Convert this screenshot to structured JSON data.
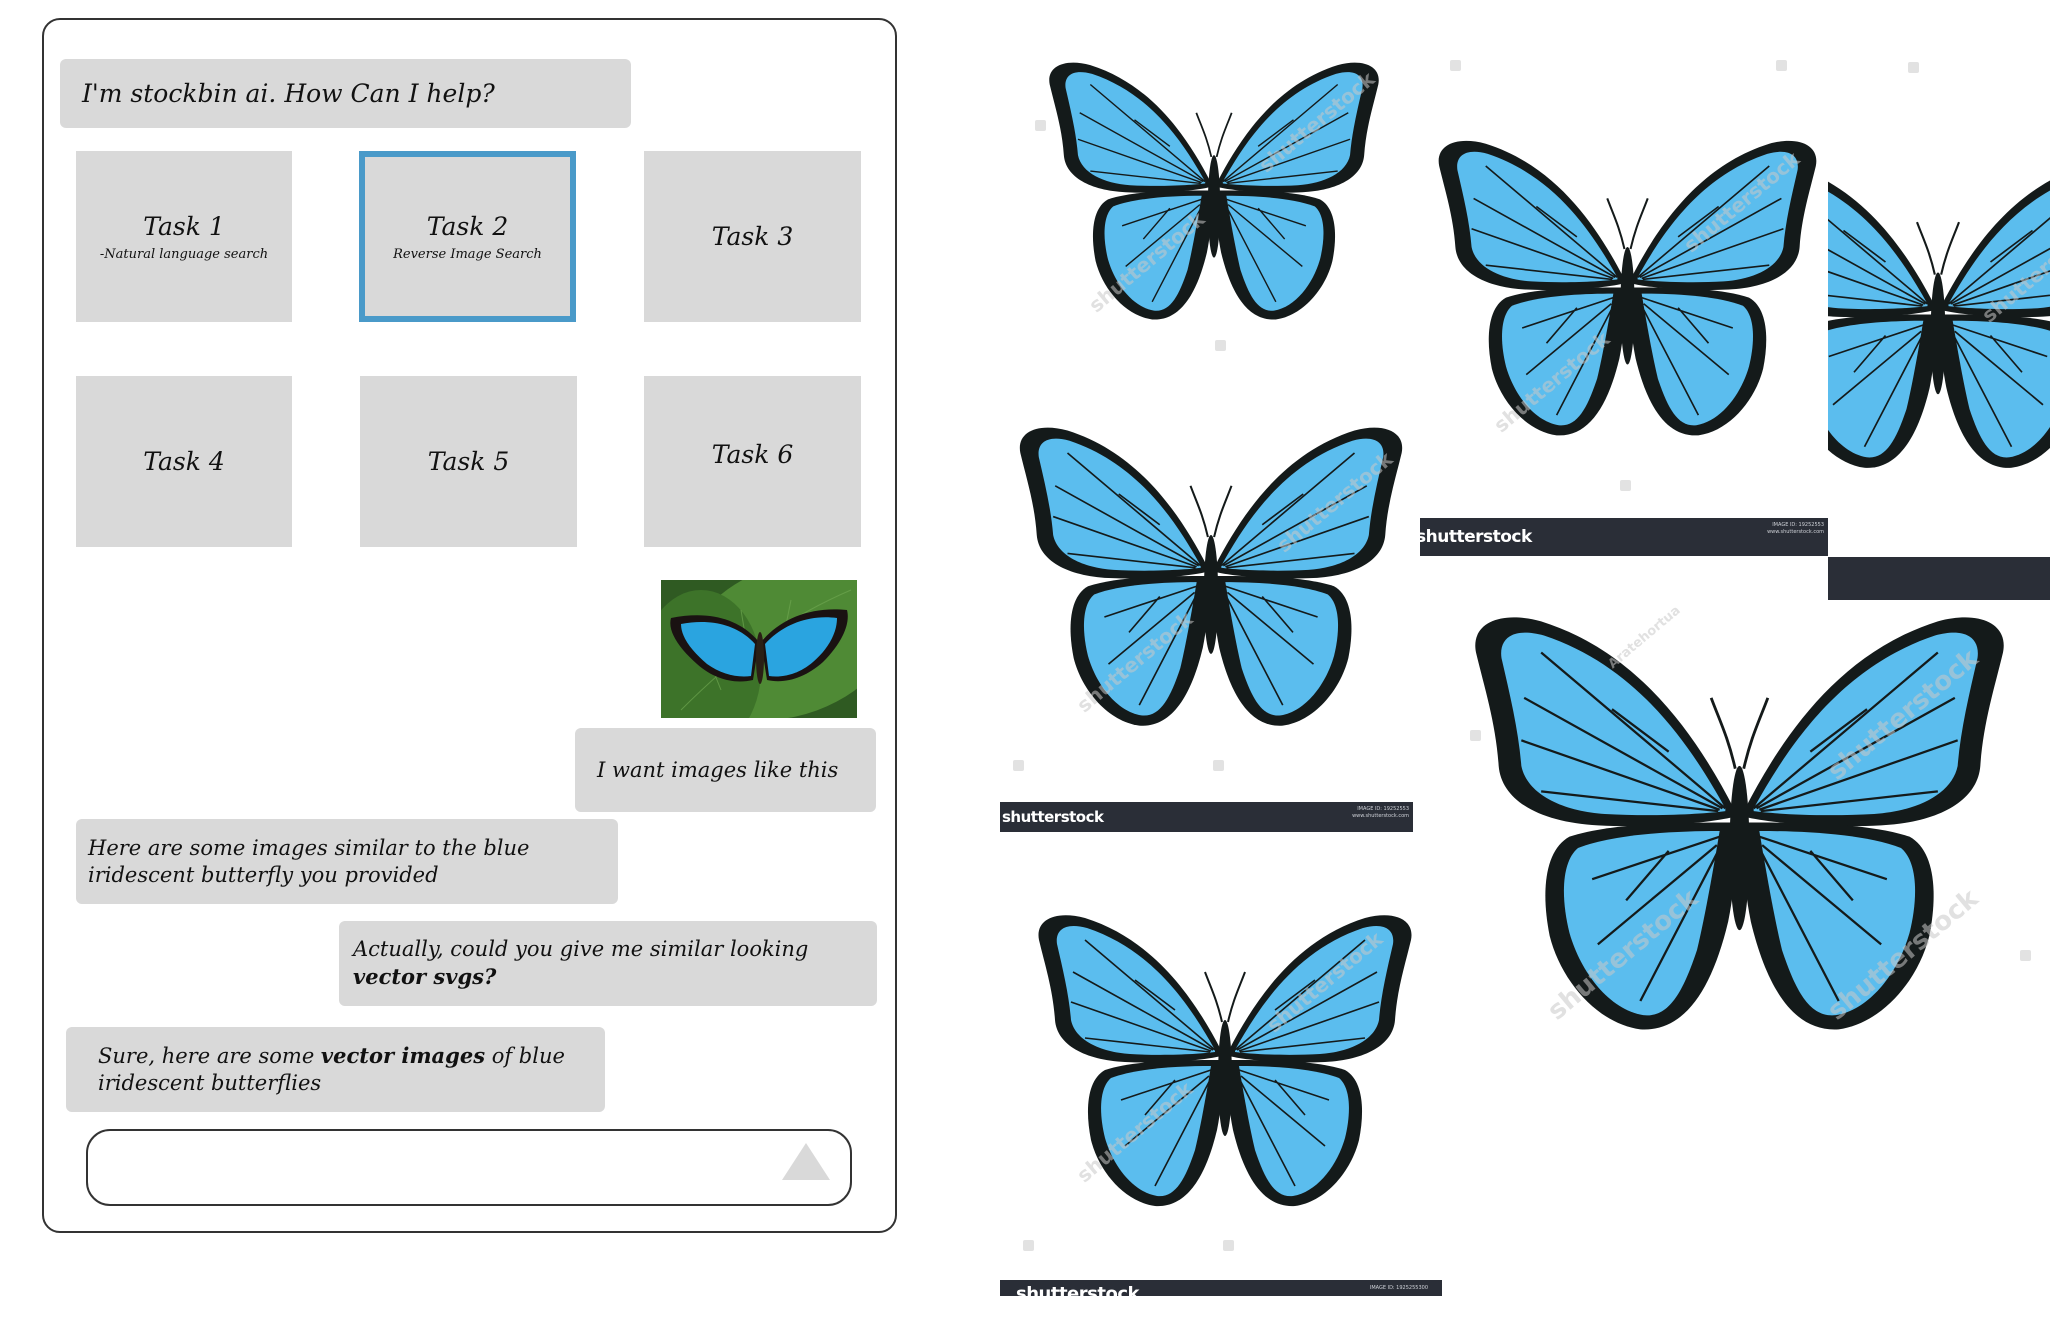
{
  "chat": {
    "greeting": "I'm stockbin ai.  How Can I help?",
    "tasks": [
      {
        "title": "Task 1",
        "subtitle": "-Natural language search",
        "selected": false
      },
      {
        "title": "Task 2",
        "subtitle": "Reverse Image Search",
        "selected": true
      },
      {
        "title": "Task 3",
        "subtitle": "",
        "selected": false
      },
      {
        "title": "Task 4",
        "subtitle": "",
        "selected": false
      },
      {
        "title": "Task 5",
        "subtitle": "",
        "selected": false
      },
      {
        "title": "Task 6",
        "subtitle": "",
        "selected": false
      }
    ],
    "uploaded_image": {
      "alt": "Blue iridescent morpho butterfly on green leaf"
    },
    "messages": [
      {
        "role": "user",
        "text": "I want images like this"
      },
      {
        "role": "assistant",
        "text": "Here are some images similar to the blue iridescent butterfly you provided"
      },
      {
        "role": "user",
        "text_before": "Actually, could you give me similar looking ",
        "text_bold": "vector svgs?",
        "text_after": ""
      },
      {
        "role": "assistant",
        "text_before": "Sure, here are some ",
        "text_bold": "vector images",
        "text_after": " of blue iridescent butterflies"
      }
    ],
    "input": {
      "value": "",
      "placeholder": ""
    },
    "send_icon": "triangle-up-send-icon"
  },
  "results": {
    "watermark_brand": "shutterstock",
    "watermark_author": "Aratehortua",
    "footer_logo": "shutterstock",
    "footer_image_id_a": "IMAGE ID: 19252553",
    "footer_image_id_b": "IMAGE ID: 1925255300",
    "footer_site": "www.shutterstock.com",
    "colors": {
      "wing": "#5bbdee",
      "outline": "#141a1a",
      "footer": "#2a2e37",
      "selected_task": "#4a9ac9",
      "bubble": "#d9d9d9"
    }
  }
}
